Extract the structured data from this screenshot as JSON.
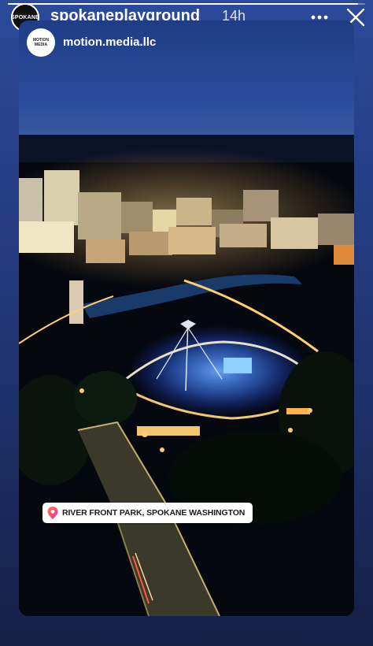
{
  "story": {
    "progress": 0.98,
    "account": {
      "username": "spokaneplayground",
      "avatar_text": "SPOKANE",
      "time": "14h"
    },
    "sub_account": {
      "username": "motion.media.llc",
      "avatar_text": "MOTION MEDIA"
    },
    "icons": {
      "more": "more-horizontal-icon",
      "close": "close-icon",
      "pin": "location-pin-icon"
    },
    "location_sticker": {
      "label": "RIVER FRONT PARK, SPOKANE WASHINGTON"
    }
  },
  "colors": {
    "background_top": "#2b4a9a",
    "background_bottom": "#142046",
    "night_sky": "#1f3d86",
    "stage_light": "#3d7bff",
    "pin_accent": "#ff4f6d"
  }
}
